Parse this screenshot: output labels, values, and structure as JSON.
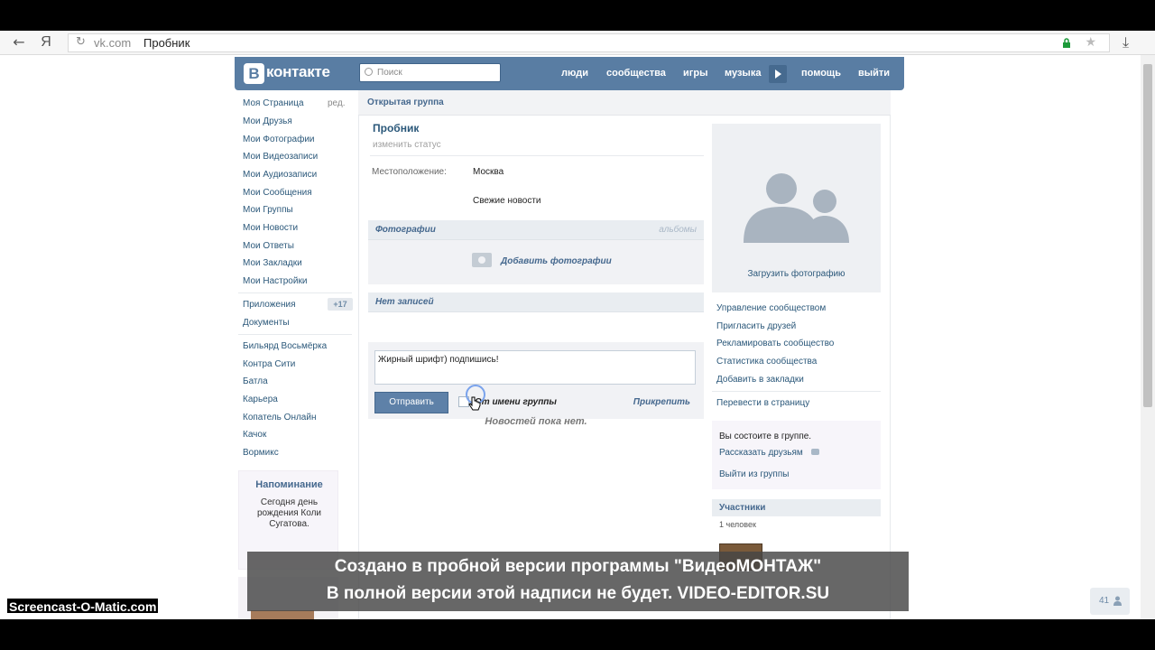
{
  "browser": {
    "back_icon": "arrow-left-icon",
    "yandex_label": "Я",
    "url_domain": "vk.com",
    "url_title": "Пробник"
  },
  "header": {
    "logo_letter": "В",
    "logo_text": "контакте",
    "search_placeholder": "Поиск",
    "nav": [
      "люди",
      "сообщества",
      "игры",
      "музыка",
      "помощь",
      "выйти"
    ]
  },
  "left_menu": {
    "edit_label": "ред.",
    "items": [
      "Моя Страница",
      "Мои Друзья",
      "Мои Фотографии",
      "Мои Видеозаписи",
      "Мои Аудиозаписи",
      "Мои Сообщения",
      "Мои Группы",
      "Мои Новости",
      "Мои Ответы",
      "Мои Закладки",
      "Мои Настройки"
    ],
    "apps": [
      "Приложения",
      "Документы"
    ],
    "apps_badge": "+17",
    "games": [
      "Бильярд Восьмёрка",
      "Контра Сити",
      "Батла",
      "Карьера",
      "Копатель Онлайн",
      "Качок",
      "Вормикс"
    ],
    "reminder_title": "Напоминание",
    "reminder_text": "Сегодня день рождения Коли Сугатова."
  },
  "main": {
    "group_type": "Открытая группа",
    "group_name": "Пробник",
    "change_status": "изменить статус",
    "location_label": "Местоположение:",
    "location_value": "Москва",
    "news_link": "Свежие новости",
    "photos_title": "Фотографии",
    "albums_link": "альбомы",
    "add_photos": "Добавить фотографии",
    "posts_title": "Нет записей",
    "post_text": "Жирный шрифт) подпишись!",
    "send_button": "Отправить",
    "from_group_label": "От имени группы",
    "attach_link": "Прикрепить",
    "no_news": "Новостей пока нет."
  },
  "right": {
    "upload_photo": "Загрузить фотографию",
    "actions": [
      "Управление сообществом",
      "Пригласить друзей",
      "Рекламировать сообщество",
      "Статистика сообщества",
      "Добавить в закладки"
    ],
    "convert_page": "Перевести в страницу",
    "member_status": "Вы состоите в группе.",
    "tell_friends": "Рассказать друзьям",
    "leave_group": "Выйти из группы",
    "participants_title": "Участники",
    "participants_count": "1 человек"
  },
  "counter": "41",
  "watermark": {
    "line1": "Создано в пробной версии программы \"ВидеоМОНТАЖ\"",
    "line2": "В полной версии этой надписи не будет. VIDEO-EDITOR.SU",
    "screencast": "Screencast-O-Matic.com"
  },
  "colors": {
    "vk_blue": "#597da3",
    "link": "#2b587a"
  }
}
